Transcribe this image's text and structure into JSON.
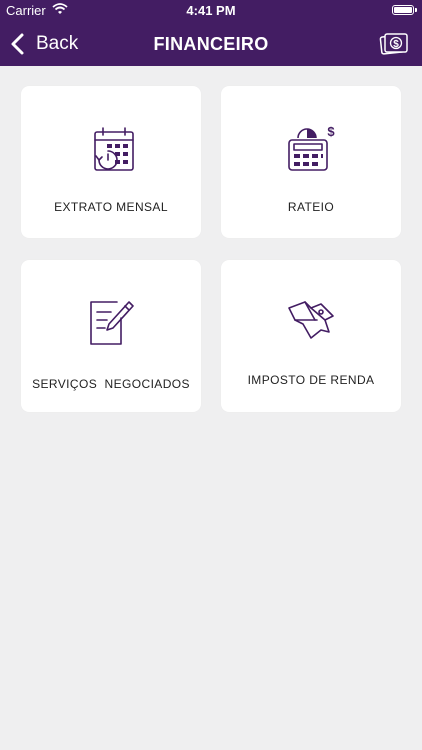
{
  "status_bar": {
    "carrier": "Carrier",
    "time": "4:41 PM"
  },
  "nav": {
    "back_label": "Back",
    "title": "FINANCEIRO"
  },
  "colors": {
    "brand": "#431d63",
    "icon_stroke": "#431d63",
    "background": "#efeff0"
  },
  "menu": [
    {
      "label": "EXTRATO MENSAL",
      "icon": "calendar-icon"
    },
    {
      "label": "RATEIO",
      "icon": "calculator-icon"
    },
    {
      "label": "SERVIÇOS  NEGOCIADOS",
      "icon": "document-pencil-icon"
    },
    {
      "label": "IMPOSTO DE RENDA",
      "icon": "tax-lion-icon"
    }
  ]
}
